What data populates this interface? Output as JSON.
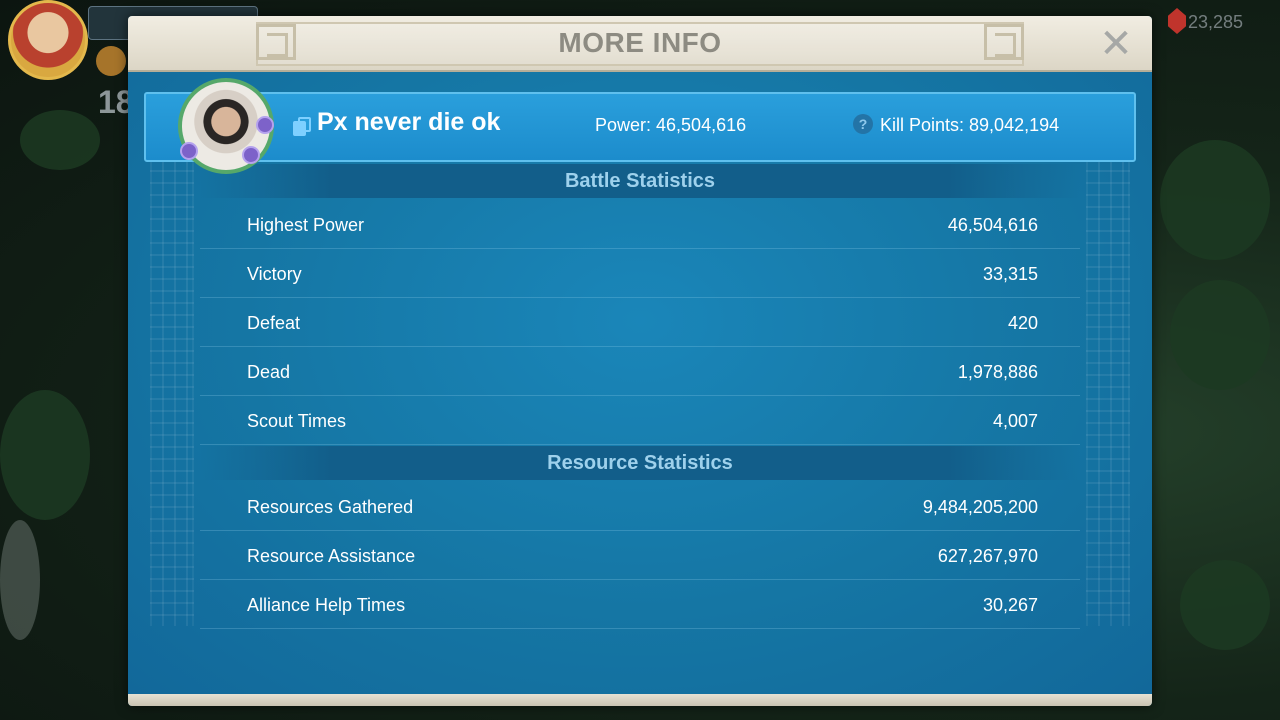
{
  "hud": {
    "gem_count": "23,285",
    "vip_level": "18"
  },
  "modal": {
    "title": "MORE INFO",
    "close_symbol": "✕"
  },
  "player": {
    "name": "Px never die ok",
    "power_text": "Power: 46,504,616",
    "kill_points_text": "Kill Points: 89,042,194",
    "help_symbol": "?"
  },
  "battle": {
    "title": "Battle Statistics",
    "rows": [
      {
        "label": "Highest Power",
        "value": "46,504,616"
      },
      {
        "label": "Victory",
        "value": "33,315"
      },
      {
        "label": "Defeat",
        "value": "420"
      },
      {
        "label": "Dead",
        "value": "1,978,886"
      },
      {
        "label": "Scout Times",
        "value": "4,007"
      }
    ]
  },
  "resource": {
    "title": "Resource Statistics",
    "rows": [
      {
        "label": "Resources Gathered",
        "value": "9,484,205,200"
      },
      {
        "label": "Resource Assistance",
        "value": "627,267,970"
      },
      {
        "label": "Alliance Help Times",
        "value": "30,267"
      }
    ]
  },
  "colors": {
    "panel_blue": "#17739f",
    "banner_blue": "#1c8ccc",
    "section_text": "#9ed1ec",
    "header_cream": "#f1ede2"
  },
  "icons": {
    "close": "close-icon",
    "copy": "copy-icon",
    "help": "help-icon",
    "gem": "gem-icon"
  }
}
